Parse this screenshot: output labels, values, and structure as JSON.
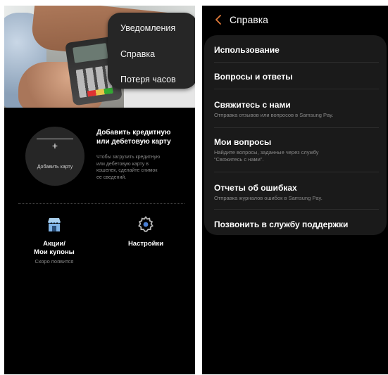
{
  "left": {
    "popup_menu": {
      "items": [
        "Уведомления",
        "Справка",
        "Потеря часов"
      ]
    },
    "add_card": {
      "plus": "+",
      "label": "Добавить карту",
      "title_line1": "Добавить кредитную",
      "title_line2": "или дебетовую карту",
      "desc_line1": "Чтобы загрузить кредитную",
      "desc_line2": "или дебетовую карту в",
      "desc_line3": "кошелек, сделайте снимок",
      "desc_line4": "ее сведений."
    },
    "tiles": {
      "promo_line1": "Акции/",
      "promo_line2": "Мои купоны",
      "promo_sub": "Скоро появится",
      "settings": "Настройки"
    }
  },
  "right": {
    "header": {
      "title": "Справка"
    },
    "rows": [
      {
        "title": "Использование"
      },
      {
        "title": "Вопросы и ответы"
      },
      {
        "title": "Свяжитесь с нами",
        "sub1": "Отправка отзывов или вопросов в Samsung Pay."
      },
      {
        "title": "Мои вопросы",
        "sub1": "Найдите вопросы, заданные через службу",
        "sub2": "“Свяжитесь с нами”."
      },
      {
        "title": "Отчеты об ошибках",
        "sub1": "Отправка журналов ошибок в Samsung Pay."
      },
      {
        "title": "Позвонить в службу поддержки"
      }
    ]
  },
  "colors": {
    "background": "#000000",
    "menu_surface": "#262626",
    "list_surface": "#1a1a1a",
    "text_primary": "#ffffff",
    "text_secondary": "#8a8a8a",
    "icon_store": "#7fb3e6",
    "icon_settings_dot": "#4a7fd4"
  }
}
